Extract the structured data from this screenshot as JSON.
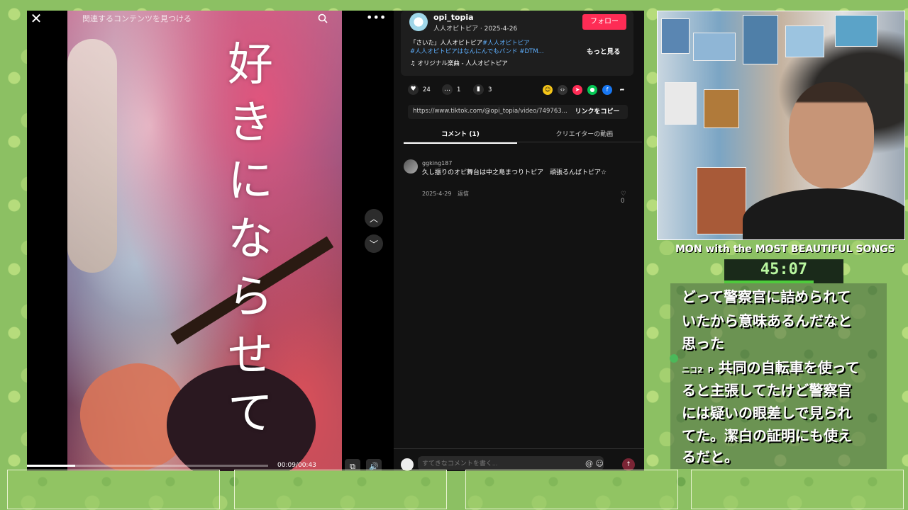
{
  "video": {
    "search_hint": "関連するコンテンツを見つける",
    "lyric_chars": [
      "好",
      "き",
      "に",
      "な",
      "ら",
      "せ",
      "て"
    ],
    "time": "00:09/00:43",
    "progress": 0.2
  },
  "post": {
    "username": "opi_topia",
    "display_name": "人人オピトピア",
    "date": "2025-4-26",
    "follow_label": "フォロー",
    "desc_plain": "「さいた」人人オピトピア",
    "desc_tags": [
      "#人人オピトピア",
      "#人人オピトピアはなんにんでもバンド",
      "#DTM..."
    ],
    "more_label": "もっと見る",
    "music": "オリジナル楽曲 - 人人オピトピア",
    "likes": "24",
    "comments_count": "1",
    "saves": "3",
    "link": "https://www.tiktok.com/@opi_topia/video/749763...",
    "copy_label": "リンクをコピー"
  },
  "tabs": {
    "comments": "コメント (1)",
    "creator_videos": "クリエイターの動画"
  },
  "comment": {
    "user": "ggking187",
    "text": "久し振りのオピ舞台は中之島まつりトピア　頑張るんばトピア☆",
    "date": "2025-4-29",
    "reply_label": "返信",
    "likes": "0"
  },
  "comment_bar": {
    "placeholder": "すてきなコメントを書く..."
  },
  "stream": {
    "scroll_title": "MON with the MOST BEAUTIFUL SONGS",
    "timer": "45:07",
    "timer_progress": 0.75,
    "chat_lines": [
      "どって警察官に詰められて",
      "いたから意味あるんだなと",
      "思った",
      "共同の自転車を使って",
      "ると主張してたけど警察官",
      "には疑いの眼差しで見られ",
      "てた。潔白の証明にも使え",
      "るだと。"
    ],
    "chat_user": "ニコ2",
    "chat_user_suffix": "P"
  },
  "colors": {
    "follow": "#fe2c55",
    "hashtag": "#5fb0ff",
    "timer_text": "#b9f7a0",
    "timer_bar": "#4ecb3c"
  }
}
